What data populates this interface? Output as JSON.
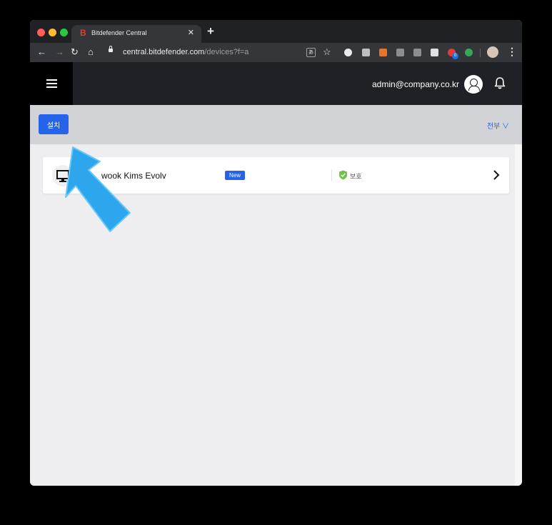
{
  "browser": {
    "tab_title": "Bitdefender Central",
    "tab_favicon": "B",
    "url_host": "central.bitdefender.com",
    "url_path": "/devices?f=a",
    "extension_badge": "0"
  },
  "header": {
    "user_email": "admin@company.co.kr"
  },
  "actionbar": {
    "install_label": "설치",
    "filter_label": "전부 ∨"
  },
  "devices": [
    {
      "name": "wook Kims Evolv",
      "badge": "New",
      "status": "보호"
    }
  ],
  "colors": {
    "accent": "#2563eb",
    "header_bg": "#1f2127",
    "protected": "#6cc24a",
    "pointer": "#2ea6ee"
  },
  "icons": [
    "hamburger-icon",
    "user-avatar-icon",
    "bell-icon",
    "desktop-icon",
    "shield-check-icon",
    "chevron-right-icon",
    "pointer-arrow-icon"
  ]
}
